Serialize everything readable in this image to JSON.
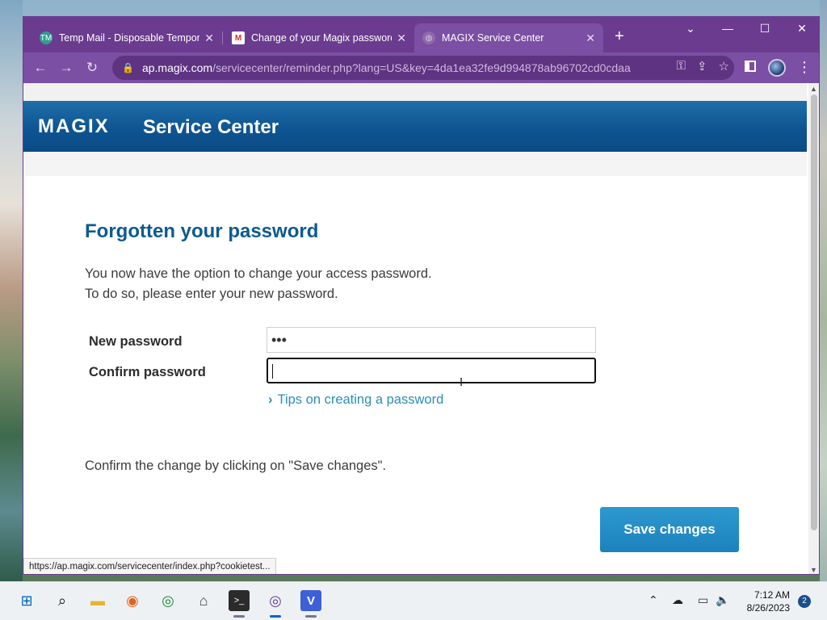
{
  "browser": {
    "tabs": [
      {
        "title": "Temp Mail - Disposable Tempora",
        "icon": "tempmail-icon",
        "active": false
      },
      {
        "title": "Change of your Magix password",
        "icon": "gmail-icon",
        "active": false
      },
      {
        "title": "MAGIX Service Center",
        "icon": "globe-icon",
        "active": true
      }
    ],
    "new_tab_label": "+",
    "url_host": "ap.magix.com",
    "url_path": "/servicecenter/reminder.php?lang=US&key=4da1ea32fe9d994878ab96702cd0cdaa",
    "status_link": "https://ap.magix.com/servicecenter/index.php?cookietest..."
  },
  "page": {
    "logo": "MAGIX",
    "header_title": "Service Center",
    "heading": "Forgotten your password",
    "intro_line1": "You now have the option to change your access password.",
    "intro_line2": "To do so, please enter your new password.",
    "new_password_label": "New password",
    "new_password_value": "•••",
    "confirm_password_label": "Confirm password",
    "confirm_password_value": "",
    "tips_link": "Tips on creating a password",
    "confirm_text": "Confirm the change by clicking on \"Save changes\".",
    "save_button": "Save changes",
    "accent_color": "#0d5a91",
    "button_color": "#1c82bd"
  },
  "taskbar": {
    "time": "7:12 AM",
    "date": "8/26/2023",
    "notification_count": "2",
    "apps": [
      "start-icon",
      "search-icon",
      "file-explorer-icon",
      "firefox-icon",
      "chrome-icon",
      "hat-icon",
      "terminal-icon",
      "chrome-active-icon",
      "vpn-v-icon"
    ]
  }
}
